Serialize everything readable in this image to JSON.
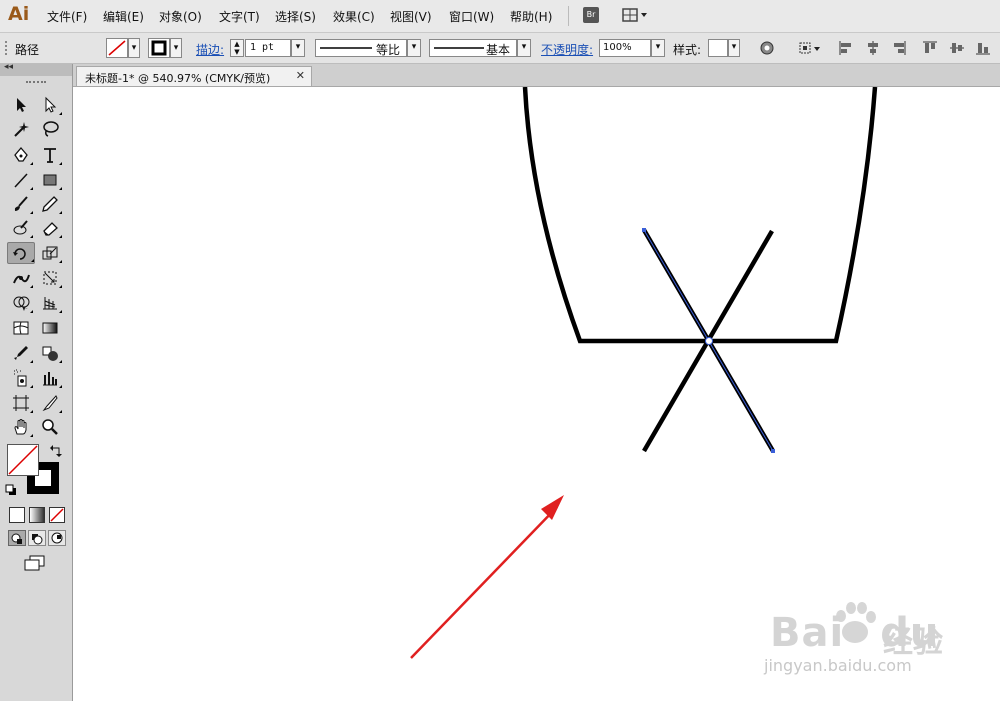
{
  "app": {
    "logo": "Ai",
    "bridge_label": "Br"
  },
  "menu": {
    "items": [
      "文件(F)",
      "编辑(E)",
      "对象(O)",
      "文字(T)",
      "选择(S)",
      "效果(C)",
      "视图(V)",
      "窗口(W)",
      "帮助(H)"
    ]
  },
  "control_bar": {
    "selection_type": "路径",
    "stroke_label": "描边:",
    "stroke_weight": "1 pt",
    "profile_label": "等比",
    "brush_label": "基本",
    "opacity_label": "不透明度:",
    "opacity_value": "100%",
    "style_label": "样式:"
  },
  "tools_panel": {
    "collapse_label": "◂◂"
  },
  "document": {
    "tab_title": "未标题-1* @ 540.97% (CMYK/预览)",
    "close_glyph": "✕"
  },
  "watermark": {
    "brand": "Bai",
    "brand2": "du",
    "cn": "经验",
    "url": "jingyan.baidu.com"
  },
  "colors": {
    "annotation_arrow": "#e02020",
    "selected_path": "#3a5fd8",
    "stroke": "#000000",
    "brand_logo": "#9a5a1a"
  }
}
